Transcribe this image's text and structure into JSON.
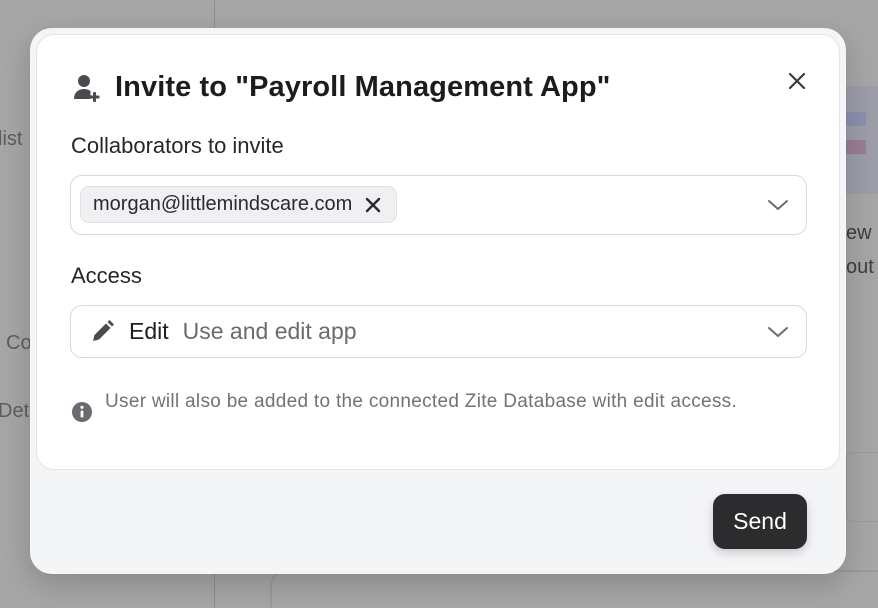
{
  "background": {
    "texts": [
      "list",
      "ew",
      "out",
      "Co",
      "Det"
    ]
  },
  "modal": {
    "title": "Invite to \"Payroll Management App\"",
    "collaborators_label": "Collaborators to invite",
    "collaborators": [
      {
        "email": "morgan@littlemindscare.com"
      }
    ],
    "access_label": "Access",
    "access": {
      "value": "Edit",
      "description": "Use and edit app"
    },
    "info_text": "User will also be added to the connected Zite Database with edit access.",
    "send_label": "Send"
  },
  "icons": {
    "header": "user-plus-icon",
    "close": "close-icon",
    "chip_remove": "x-icon",
    "dropdown": "chevron-down-icon",
    "access": "pencil-icon",
    "info": "info-icon"
  },
  "colors": {
    "overlay": "#a6a6a6",
    "modal_bg": "#f4f5f7",
    "primary_button": "#2c2c2e",
    "muted_text": "#727278"
  }
}
